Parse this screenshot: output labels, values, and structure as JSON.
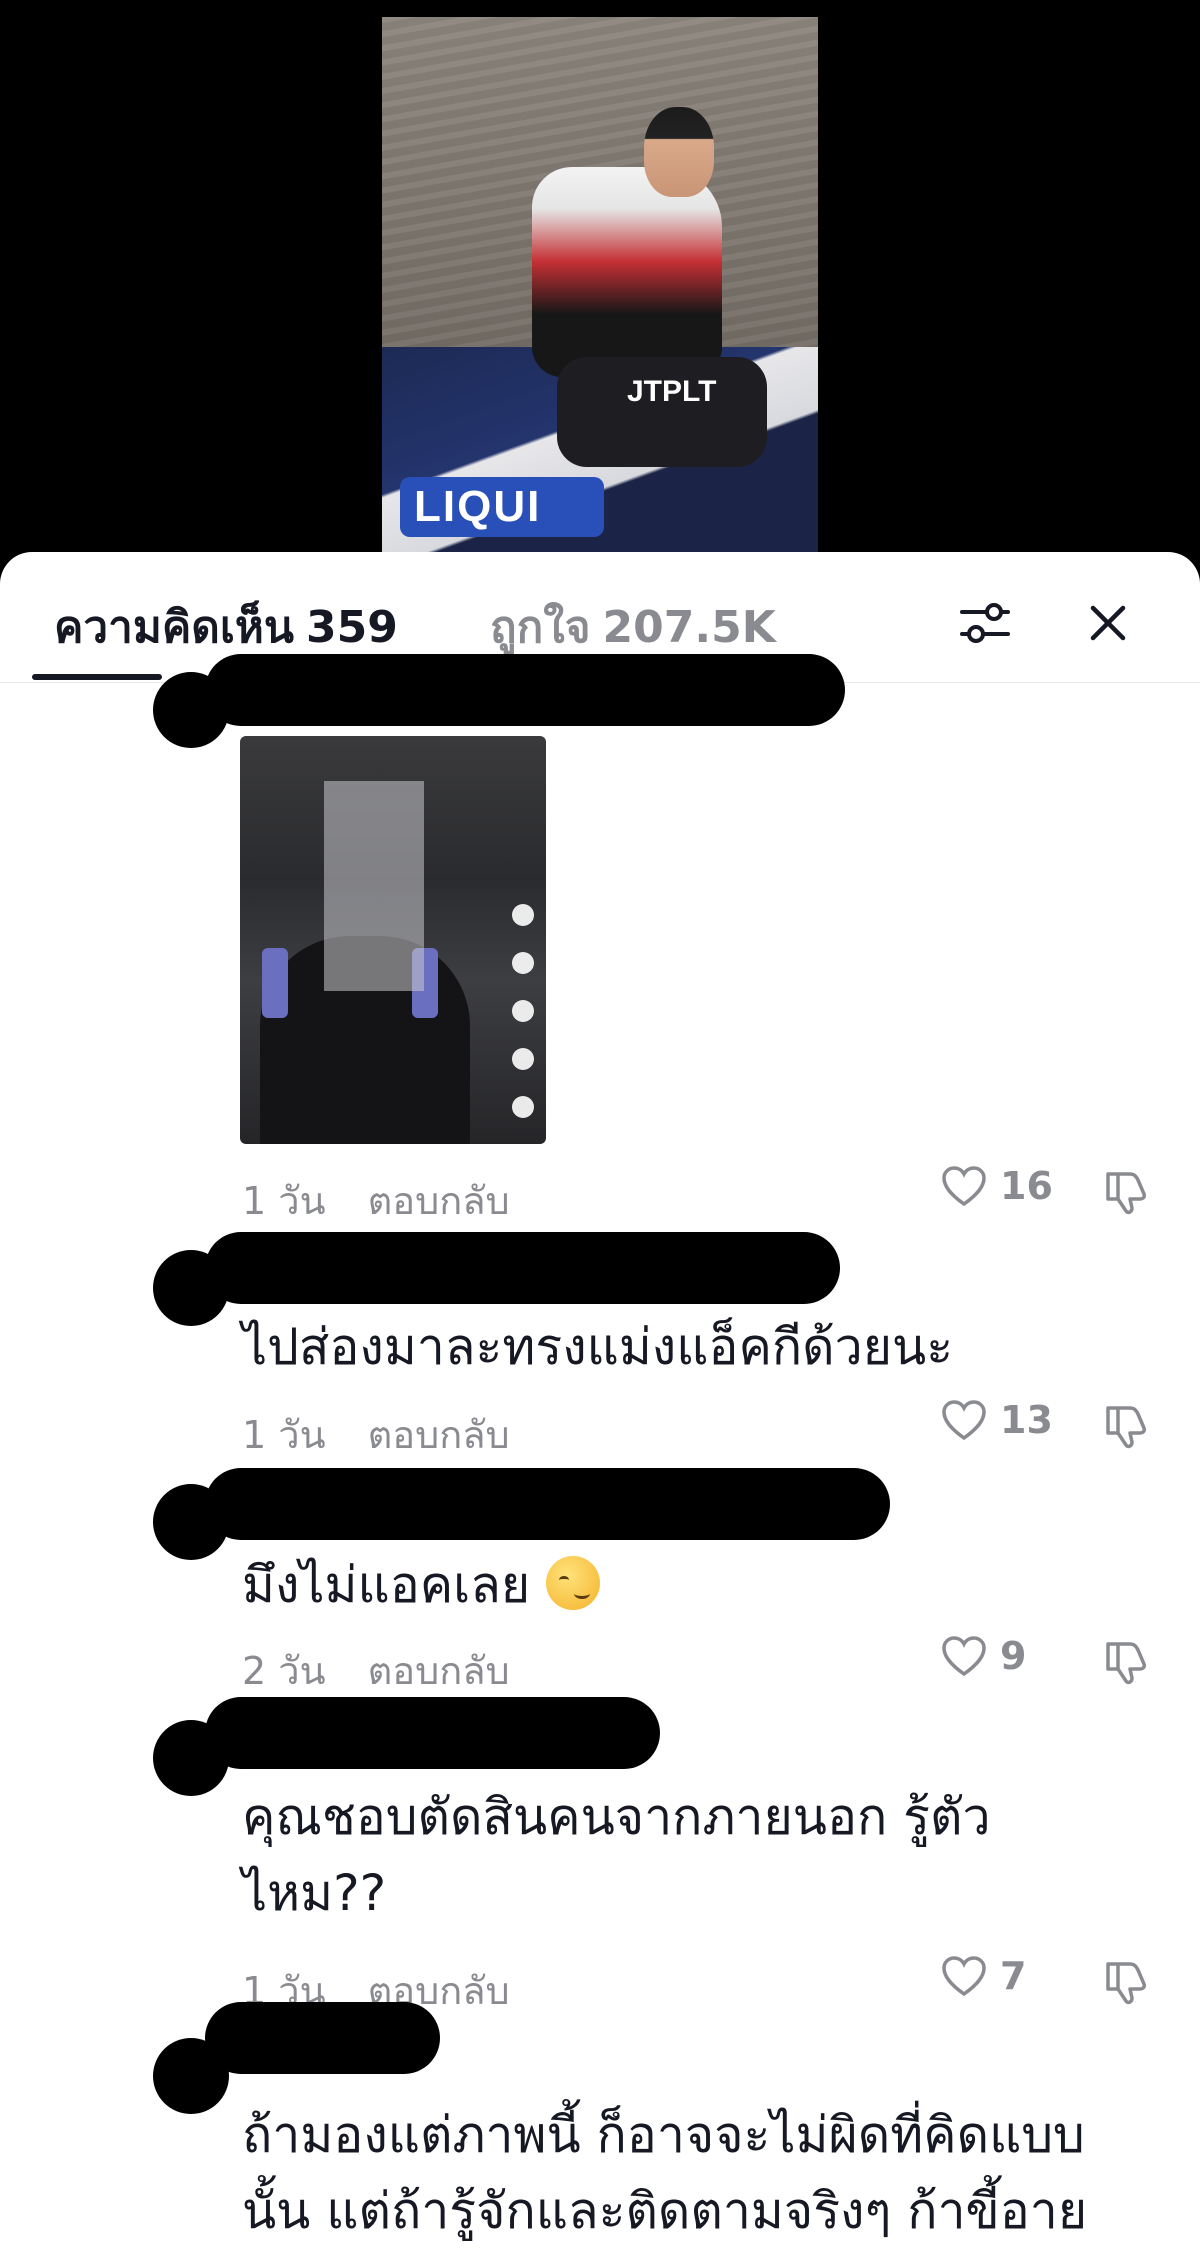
{
  "video": {
    "jetski_logo_text": "LIQUI",
    "rider_pants_text": "JTPLT"
  },
  "header": {
    "comments_label": "ความคิดเห็น",
    "comments_count": "359",
    "likes_label": "ถูกใจ",
    "likes_count": "207.5K"
  },
  "comments": [
    {
      "text": "",
      "age": "1 วัน",
      "reply": "ตอบกลับ",
      "likes": "16",
      "has_media": true
    },
    {
      "text": "ไปส่องมาละทรงแม่งแอ็คกีด้วยนะ",
      "age": "1 วัน",
      "reply": "ตอบกลับ",
      "likes": "13"
    },
    {
      "text": "มึงไม่แอคเลย",
      "emoji": "smirk-emoji",
      "age": "2 วัน",
      "reply": "ตอบกลับ",
      "likes": "9"
    },
    {
      "text_line1": "คุณชอบตัดสินคนจากภายนอก รู้ตัว",
      "text_line2": "ไหม??",
      "age": "1 วัน",
      "reply": "ตอบกลับ",
      "likes": "7"
    },
    {
      "text_line1": "ถ้ามองแต่ภาพนี้ ก็อาจจะไม่ผิดที่คิดแบบ",
      "text_line2": "นั้น แต่ถ้ารู้จักและติดตามจริงๆ ก้าขี้อาย"
    }
  ]
}
